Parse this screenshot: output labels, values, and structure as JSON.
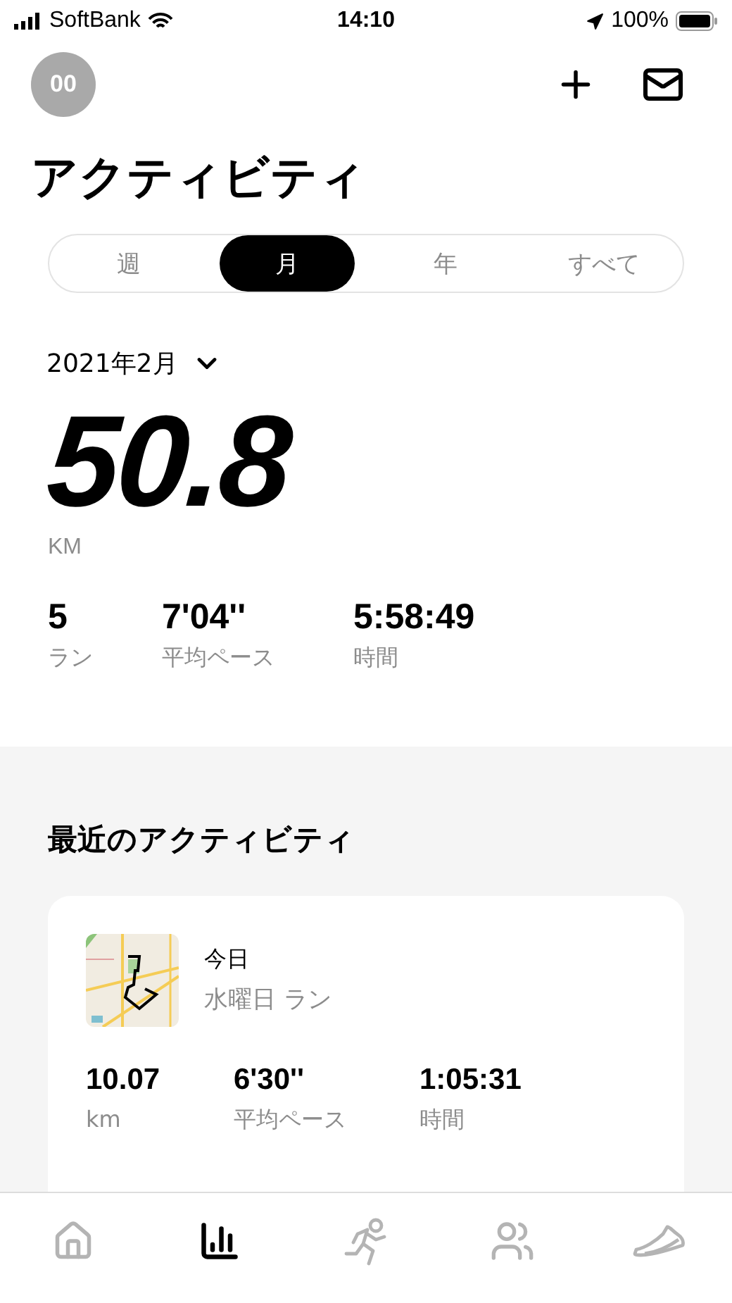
{
  "status_bar": {
    "carrier": "SoftBank",
    "time": "14:10",
    "battery": "100%"
  },
  "header": {
    "avatar_initials": "00"
  },
  "title": "アクティビティ",
  "period_tabs": [
    {
      "label": "週",
      "selected": false
    },
    {
      "label": "月",
      "selected": true
    },
    {
      "label": "年",
      "selected": false
    },
    {
      "label": "すべて",
      "selected": false
    }
  ],
  "period": "2021年2月",
  "total": {
    "value": "50.8",
    "unit": "KM"
  },
  "stats": [
    {
      "value": "5",
      "label": "ラン"
    },
    {
      "value": "7'04''",
      "label": "平均ペース"
    },
    {
      "value": "5:58:49",
      "label": "時間"
    }
  ],
  "recent": {
    "heading": "最近のアクティビティ",
    "card": {
      "day": "今日",
      "title": "水曜日 ラン",
      "stats": [
        {
          "value": "10.07",
          "label": "km"
        },
        {
          "value": "6'30''",
          "label": "平均ペース"
        },
        {
          "value": "1:05:31",
          "label": "時間"
        }
      ]
    }
  },
  "tab_bar": [
    {
      "kind": "home",
      "selected": false
    },
    {
      "kind": "activity",
      "selected": true
    },
    {
      "kind": "run",
      "selected": false
    },
    {
      "kind": "club",
      "selected": false
    },
    {
      "kind": "shoes",
      "selected": false
    }
  ]
}
